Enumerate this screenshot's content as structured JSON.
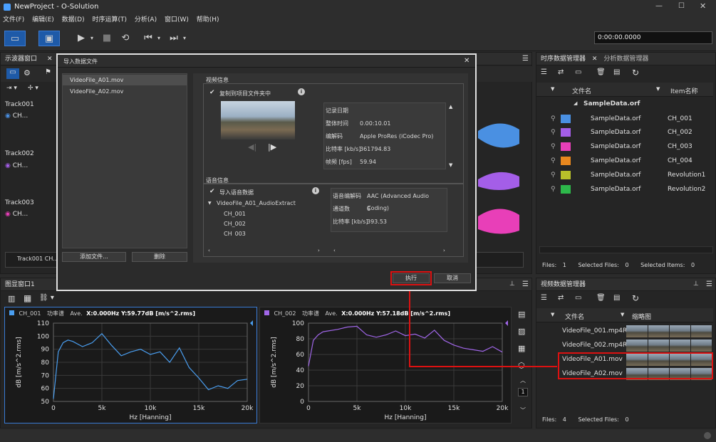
{
  "app": {
    "title": "NewProject - O-Solution",
    "time": "0:00:00.0000"
  },
  "menu": [
    "文件(F)",
    "编辑(E)",
    "数据(D)",
    "时序运算(T)",
    "分析(A)",
    "窗口(W)",
    "帮助(H)"
  ],
  "left_panel": {
    "tab": "示波器窗口",
    "tracks": [
      {
        "name": "Track001",
        "ch": "CH..."
      },
      {
        "name": "Track002",
        "ch": "CH..."
      },
      {
        "name": "Track003",
        "ch": "CH..."
      }
    ],
    "bottom_label": "Track001 CH..."
  },
  "dialog": {
    "title": "导入数据文件",
    "files": [
      "VideoFile_A01.mov",
      "VideoFile_A02.mov"
    ],
    "add_button": "添加文件...",
    "delete_button": "删除",
    "video_section": "视频信息",
    "copy_checkbox": "复制到项目文件夹中",
    "video_info": [
      [
        "记录日期",
        ""
      ],
      [
        "整体时间",
        "0.00:10.01"
      ],
      [
        "编解码",
        "Apple ProRes (iCodec Pro)"
      ],
      [
        "比特率 [kb/s]",
        "361794.83"
      ],
      [
        "帧频 [fps]",
        "59.94"
      ]
    ],
    "audio_section": "语音信息",
    "import_audio": "导入语音数据",
    "audio_tree": {
      "root": "VideoFile_A01_AudioExtract",
      "children": [
        "CH_001",
        "CH_002",
        "CH_003"
      ]
    },
    "audio_info": [
      [
        "语音编解码",
        "AAC (Advanced Audio Coding)"
      ],
      [
        "通道数",
        "6"
      ],
      [
        "比特率 [kb/s]",
        "393.53"
      ]
    ],
    "execute_button": "执行",
    "cancel_button": "取消"
  },
  "time_data_manager": {
    "tabs": [
      "时序数据管理器",
      "分析数据管理器"
    ],
    "col_name": "文件名",
    "col_item": "Item名称",
    "group": "SampleData.orf",
    "rows": [
      {
        "file": "SampleData.orf",
        "item": "CH_001",
        "color": "#4a90e2"
      },
      {
        "file": "SampleData.orf",
        "item": "CH_002",
        "color": "#a45ee8"
      },
      {
        "file": "SampleData.orf",
        "item": "CH_003",
        "color": "#e83fb8"
      },
      {
        "file": "SampleData.orf",
        "item": "CH_004",
        "color": "#e8871e"
      },
      {
        "file": "SampleData.orf",
        "item": "Revolution1",
        "color": "#b8c02a"
      },
      {
        "file": "SampleData.orf",
        "item": "Revolution2",
        "color": "#2db84a"
      }
    ],
    "status": {
      "files": "Files:",
      "files_n": "1",
      "selected": "Selected Files:",
      "selected_n": "0",
      "items": "Selected Items:",
      "items_n": "0"
    }
  },
  "video_data_manager": {
    "title": "视频数据管理器",
    "col_name": "文件名",
    "col_thumb": "缩略图",
    "rows": [
      "VideoFile_001.mp4Ref",
      "VideoFile_002.mp4Ref",
      "VideoFile_A01.mov",
      "VideoFile_A02.mov"
    ],
    "status": {
      "files": "Files:",
      "files_n": "4",
      "selected": "Selected Files:",
      "selected_n": "0"
    }
  },
  "graph_window": {
    "title": "图显窗口1",
    "charts": [
      {
        "ch": "CH_001",
        "kind": "功率谱",
        "ave": "Ave.",
        "readout": "X:0.000Hz Y:59.77dB [m/s^2.rms]"
      },
      {
        "ch": "CH_002",
        "kind": "功率谱",
        "ave": "Ave.",
        "readout": "X:0.000Hz Y:57.18dB [m/s^2.rms]"
      }
    ],
    "side_num": "1"
  },
  "chart_data": [
    {
      "type": "line",
      "series": [
        {
          "name": "CH_001",
          "color": "#4a9ef0",
          "x": [
            0,
            500,
            1000,
            1500,
            2000,
            3000,
            4000,
            5000,
            6000,
            7000,
            8000,
            9000,
            10000,
            11000,
            12000,
            13000,
            14000,
            15000,
            16000,
            17000,
            18000,
            19000,
            20000
          ],
          "values": [
            52,
            88,
            95,
            97,
            96,
            92,
            95,
            102,
            93,
            85,
            88,
            90,
            86,
            88,
            80,
            91,
            76,
            68,
            59,
            62,
            60,
            66,
            67
          ]
        }
      ],
      "xlabel": "Hz [Hanning]",
      "ylabel": "dB [m/s^2.rms]",
      "xlim": [
        0,
        20000
      ],
      "ylim": [
        50,
        110
      ],
      "xticks": [
        "0",
        "5k",
        "10k",
        "15k",
        "20k"
      ],
      "yticks": [
        "110",
        "100",
        "90",
        "80",
        "70",
        "60",
        "50"
      ]
    },
    {
      "type": "line",
      "series": [
        {
          "name": "CH_002",
          "color": "#a066e8",
          "x": [
            0,
            500,
            1000,
            1500,
            2000,
            3000,
            4000,
            5000,
            6000,
            7000,
            8000,
            9000,
            10000,
            11000,
            12000,
            13000,
            14000,
            15000,
            16000,
            17000,
            18000,
            19000,
            20000
          ],
          "values": [
            45,
            78,
            85,
            89,
            90,
            92,
            95,
            96,
            85,
            82,
            85,
            90,
            84,
            86,
            81,
            91,
            78,
            72,
            68,
            66,
            64,
            70,
            63
          ]
        }
      ],
      "xlabel": "Hz [Hanning]",
      "ylabel": "dB [m/s^2.rms]",
      "xlim": [
        0,
        20000
      ],
      "ylim": [
        0,
        100
      ],
      "xticks": [
        "0",
        "5k",
        "10k",
        "15k",
        "20k"
      ],
      "yticks": [
        "100",
        "80",
        "60",
        "40",
        "20",
        "0"
      ]
    }
  ]
}
